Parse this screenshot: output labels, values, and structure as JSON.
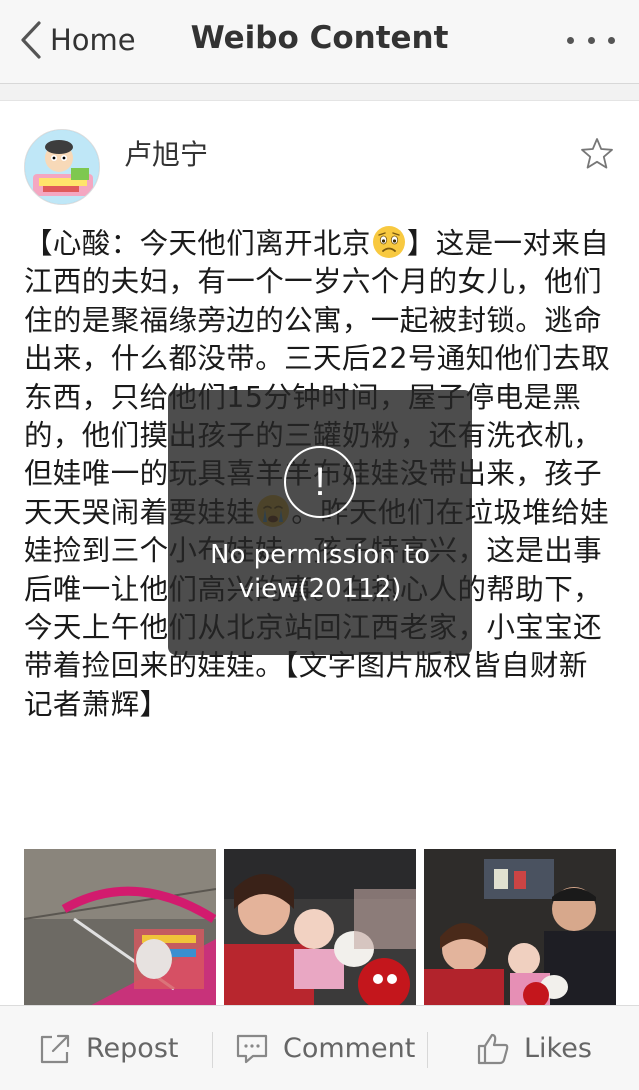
{
  "nav": {
    "back_label": "Home",
    "title": "Weibo Content",
    "more_icon": "more-dots-icon"
  },
  "post": {
    "author": "卢旭宁",
    "text_1": "【心酸：今天他们离开北京",
    "text_2": "】这是一对来自江西的夫妇，有一个一岁六个月的女儿，他们住的是聚福缘旁边的公寓，一起被封锁。逃命出来，什么都没带。三天后22号通知他们去取东西，只给他们15分钟时间，屋子停电是黑的，他们摸出孩子的三罐奶粉，还有洗衣机，但娃唯一的玩具喜羊羊布娃娃没带出来，孩子天天哭闹着要娃娃",
    "text_3": "。昨天他们在垃圾堆给娃娃捡到三个小布娃娃，孩子特高兴，这是出事后唯一让他们高兴的事。在热心人的帮助下，今天上午他们从北京站回江西老家，小宝宝还带着捡回来的娃娃。【文字图片版权皆自财新记者萧辉】",
    "emoji_1": "sad-face-emoji",
    "emoji_2": "crying-face-emoji",
    "star_icon": "star-outline-icon"
  },
  "toast": {
    "icon": "exclamation-circle-icon",
    "glyph": "!",
    "message": "No permission to view(20112)"
  },
  "actions": {
    "repost": "Repost",
    "comment": "Comment",
    "likes": "Likes"
  },
  "colors": {
    "toast_bg": "#262626",
    "nav_bg": "#f7f7f7",
    "text": "#1a1a1a",
    "muted": "#666666"
  }
}
